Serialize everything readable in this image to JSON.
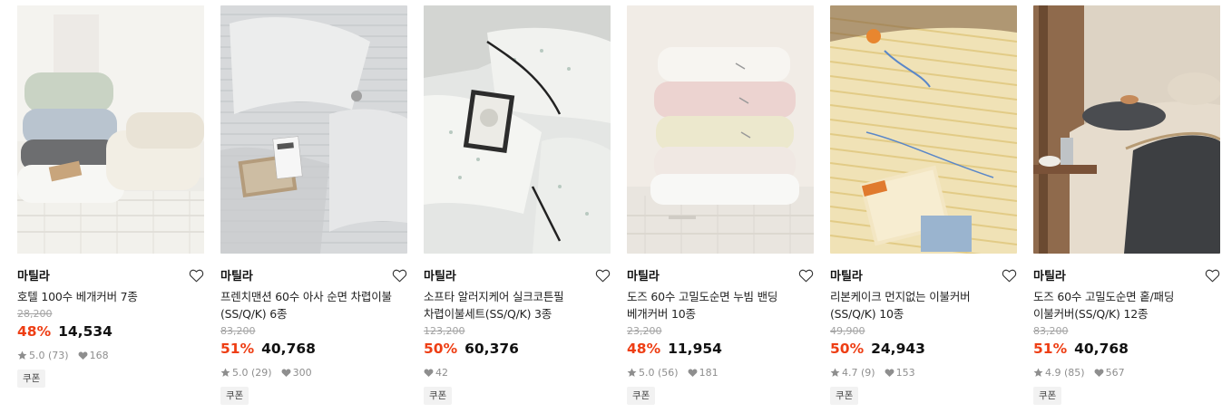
{
  "products": [
    {
      "brand": "마틸라",
      "title_line1": "호텔 100수 베개커버 7종",
      "title_line2": "",
      "original_price": "28,200",
      "discount": "48%",
      "price": "14,534",
      "rating": "5.0",
      "review_count": "(73)",
      "likes": "168",
      "coupon": "쿠폰",
      "image": "pillow-stack-cream"
    },
    {
      "brand": "마틸라",
      "title_line1": "프렌치맨션 60수 아사 순면 차렵이불",
      "title_line2": "(SS/Q/K) 6종",
      "original_price": "83,200",
      "discount": "51%",
      "price": "40,768",
      "rating": "5.0",
      "review_count": "(29)",
      "likes": "300",
      "coupon": "쿠폰",
      "image": "grey-stripe-bedding"
    },
    {
      "brand": "마틸라",
      "title_line1": "소프타 알러지케어 실크코튼필",
      "title_line2": "차렵이불세트(SS/Q/K) 3종",
      "original_price": "123,200",
      "discount": "50%",
      "price": "60,376",
      "rating": "",
      "review_count": "",
      "likes": "42",
      "coupon": "쿠폰",
      "image": "floral-bedding-ribbon"
    },
    {
      "brand": "마틸라",
      "title_line1": "도즈 60수 고밀도순면 누빔 밴딩",
      "title_line2": "베개커버 10종",
      "original_price": "23,200",
      "discount": "48%",
      "price": "11,954",
      "rating": "5.0",
      "review_count": "(56)",
      "likes": "181",
      "coupon": "쿠폰",
      "image": "pastel-pillow-stack"
    },
    {
      "brand": "마틸라",
      "title_line1": "리본케이크 먼지없는 이불커버",
      "title_line2": "(SS/Q/K) 10종",
      "original_price": "49,900",
      "discount": "50%",
      "price": "24,943",
      "rating": "4.7",
      "review_count": "(9)",
      "likes": "153",
      "coupon": "쿠폰",
      "image": "yellow-stripe-bedding"
    },
    {
      "brand": "마틸라",
      "title_line1": "도즈 60수 고밀도순면 홑/패딩",
      "title_line2": "이불커버(SS/Q/K) 12종",
      "original_price": "83,200",
      "discount": "51%",
      "price": "40,768",
      "rating": "4.9",
      "review_count": "(85)",
      "likes": "567",
      "coupon": "쿠폰",
      "image": "charcoal-beige-bedding"
    }
  ],
  "colors": {
    "discount": "#ee3e14",
    "meta": "#8e8e8e",
    "original_price": "#a3a3a3"
  },
  "icons": {
    "wishlist": "heart-outline-icon",
    "rating": "star-icon",
    "likes": "heart-filled-icon"
  }
}
